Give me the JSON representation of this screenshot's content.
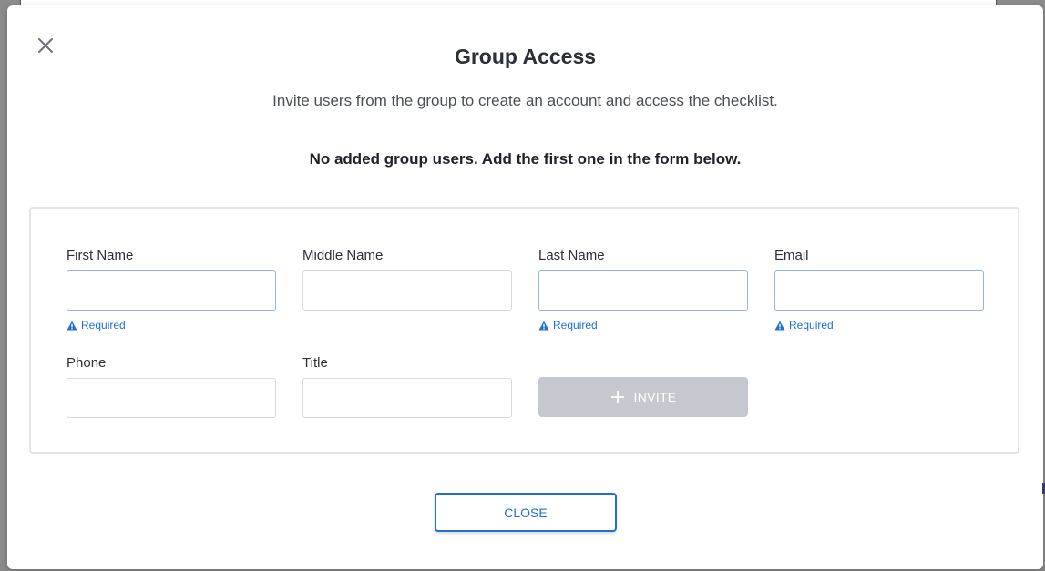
{
  "modal": {
    "title": "Group Access",
    "subtitle": "Invite users from the group to create an account and access the checklist.",
    "empty_note": "No added group users. Add the first one in the form below."
  },
  "form": {
    "fields": [
      {
        "label": "First Name",
        "value": "",
        "required_text": "Required"
      },
      {
        "label": "Middle Name",
        "value": ""
      },
      {
        "label": "Last Name",
        "value": "",
        "required_text": "Required"
      },
      {
        "label": "Email",
        "value": "",
        "required_text": "Required"
      },
      {
        "label": "Phone",
        "value": ""
      },
      {
        "label": "Title",
        "value": ""
      }
    ],
    "invite_label": "INVITE"
  },
  "footer": {
    "close_label": "CLOSE"
  },
  "icons": {
    "close": "close-icon",
    "warning": "warning-triangle-icon",
    "plus": "plus-icon"
  },
  "colors": {
    "accent": "#1f6fd6",
    "disabled_button": "#c5c9cf",
    "required_border": "#8fb3e8"
  }
}
